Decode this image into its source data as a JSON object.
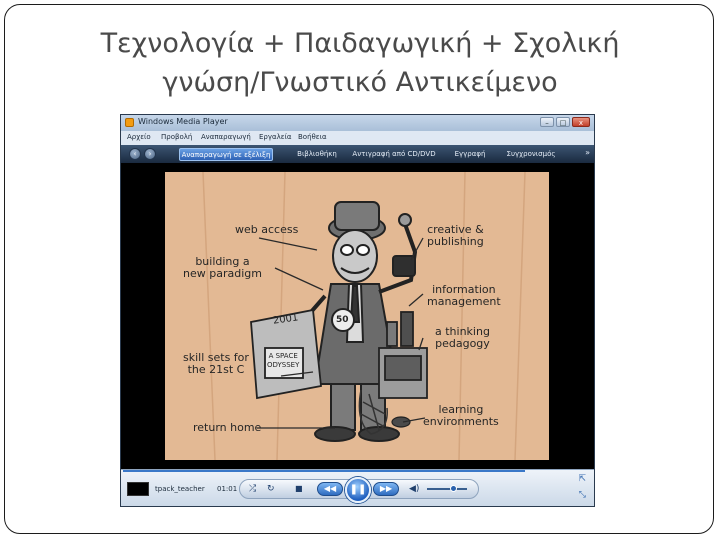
{
  "slide": {
    "title_line1": "Τεχνολογία + Παιδαγωγική + Σχολική",
    "title_line2": "γνώση/Γνωστικό Αντικείμενο"
  },
  "window": {
    "title": "Windows Media Player",
    "buttons": {
      "minimize": "–",
      "maximize": "□",
      "close": "x"
    }
  },
  "menu": [
    "Αρχείο",
    "Προβολή",
    "Αναπαραγωγή",
    "Εργαλεία",
    "Βοήθεια"
  ],
  "tabs": [
    {
      "label": "Αναπαραγωγή σε εξέλιξη",
      "active": true
    },
    {
      "label": "Βιβλιοθήκη",
      "active": false
    },
    {
      "label": "Αντιγραφή από CD/DVD",
      "active": false
    },
    {
      "label": "Εγγραφή",
      "active": false
    },
    {
      "label": "Συγχρονισμός",
      "active": false
    }
  ],
  "tabs_more": "»",
  "nav_icons": {
    "back": "back-arrow-icon",
    "forward": "forward-arrow-icon"
  },
  "video_labels": {
    "web_access": "web access",
    "creative": "creative &\npublishing",
    "paradigm": "building a\nnew paradigm",
    "information": "information\nmanagement",
    "thinking": "a thinking\npedagogy",
    "skills": "skill sets for\nthe 21st C",
    "return_home": "return home",
    "learning": "learning\nenvironments",
    "year": "2001",
    "badge": "50",
    "book": "A SPACE\nODYSSEY"
  },
  "player": {
    "now_playing": "tpack_teacher",
    "time": "01:01",
    "progress": 0.85,
    "volume": 0.65,
    "icons": {
      "shuffle": "shuffle-icon",
      "repeat": "repeat-icon",
      "stop": "stop-icon",
      "previous": "previous-icon",
      "play_pause": "pause-icon",
      "next": "next-icon",
      "volume": "speaker-icon",
      "switch_compact": "switch-to-compact-icon",
      "fullscreen": "fullscreen-icon"
    }
  },
  "colors": {
    "accent": "#2e62b5",
    "video_bg": "#e3b994",
    "title_text": "#4a4a4a"
  }
}
